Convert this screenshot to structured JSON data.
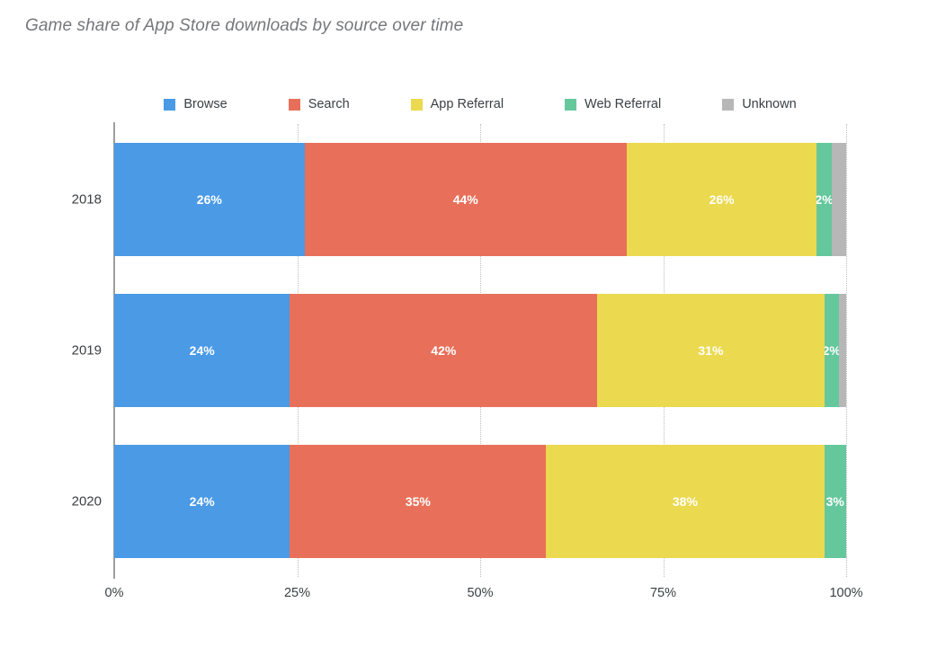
{
  "title": "Game share of App Store downloads by source over time",
  "legend": {
    "position": "top-center",
    "items": [
      {
        "label": "Browse",
        "color": "#4a9ae6",
        "icon": "legend-swatch-square"
      },
      {
        "label": "Search",
        "color": "#e8705a",
        "icon": "legend-swatch-square"
      },
      {
        "label": "App Referral",
        "color": "#ebd94f",
        "icon": "legend-swatch-square"
      },
      {
        "label": "Web Referral",
        "color": "#65c79c",
        "icon": "legend-swatch-square"
      },
      {
        "label": "Unknown",
        "color": "#b7b7b7",
        "icon": "legend-swatch-square"
      }
    ]
  },
  "axes": {
    "x": {
      "ticks": [
        "0%",
        "25%",
        "50%",
        "75%",
        "100%"
      ],
      "values": [
        0,
        25,
        50,
        75,
        100
      ],
      "min": 0,
      "max": 100,
      "grid": true
    },
    "y": {
      "ticks": [
        "2018",
        "2019",
        "2020"
      ]
    }
  },
  "chart_data": {
    "type": "bar",
    "orientation": "horizontal",
    "stacked": true,
    "stack_mode": "percent",
    "title": "Game share of App Store downloads by source over time",
    "xlabel": "",
    "ylabel": "",
    "xlim": [
      0,
      100
    ],
    "grid": true,
    "legend_position": "top-center",
    "categories": [
      "2018",
      "2019",
      "2020"
    ],
    "series": [
      {
        "name": "Browse",
        "color": "#4a9ae6",
        "values": [
          26,
          24,
          24
        ],
        "labels": [
          "26%",
          "24%",
          "24%"
        ]
      },
      {
        "name": "Search",
        "color": "#e8705a",
        "values": [
          44,
          42,
          35
        ],
        "labels": [
          "44%",
          "42%",
          "35%"
        ]
      },
      {
        "name": "App Referral",
        "color": "#ebd94f",
        "values": [
          26,
          31,
          38
        ],
        "labels": [
          "26%",
          "31%",
          "38%"
        ]
      },
      {
        "name": "Web Referral",
        "color": "#65c79c",
        "values": [
          2,
          2,
          3
        ],
        "labels": [
          "2%",
          "2%",
          "3%"
        ]
      },
      {
        "name": "Unknown",
        "color": "#b7b7b7",
        "values": [
          2,
          1,
          0
        ],
        "labels": [
          "",
          "",
          ""
        ]
      }
    ],
    "bars": [
      {
        "category": "2018",
        "segments": [
          {
            "name": "Browse",
            "value": 26,
            "label": "26%",
            "color": "#4a9ae6"
          },
          {
            "name": "Search",
            "value": 44,
            "label": "44%",
            "color": "#e8705a"
          },
          {
            "name": "App Referral",
            "value": 26,
            "label": "26%",
            "color": "#ebd94f"
          },
          {
            "name": "Web Referral",
            "value": 2,
            "label": "2%",
            "color": "#65c79c"
          },
          {
            "name": "Unknown",
            "value": 2,
            "label": "",
            "color": "#b7b7b7"
          }
        ]
      },
      {
        "category": "2019",
        "segments": [
          {
            "name": "Browse",
            "value": 24,
            "label": "24%",
            "color": "#4a9ae6"
          },
          {
            "name": "Search",
            "value": 42,
            "label": "42%",
            "color": "#e8705a"
          },
          {
            "name": "App Referral",
            "value": 31,
            "label": "31%",
            "color": "#ebd94f"
          },
          {
            "name": "Web Referral",
            "value": 2,
            "label": "2%",
            "color": "#65c79c"
          },
          {
            "name": "Unknown",
            "value": 1,
            "label": "",
            "color": "#b7b7b7"
          }
        ]
      },
      {
        "category": "2020",
        "segments": [
          {
            "name": "Browse",
            "value": 24,
            "label": "24%",
            "color": "#4a9ae6"
          },
          {
            "name": "Search",
            "value": 35,
            "label": "35%",
            "color": "#e8705a"
          },
          {
            "name": "App Referral",
            "value": 38,
            "label": "38%",
            "color": "#ebd94f"
          },
          {
            "name": "Web Referral",
            "value": 3,
            "label": "3%",
            "color": "#65c79c"
          },
          {
            "name": "Unknown",
            "value": 0,
            "label": "",
            "color": "#b7b7b7"
          }
        ]
      }
    ]
  },
  "style": {
    "axis_line_color": "#9e9e9e",
    "gridline_color": "#bdbdbd",
    "title_color": "#75777a",
    "tick_color": "#3c4043",
    "bar_label_color": "#ffffff",
    "background": "#ffffff"
  }
}
